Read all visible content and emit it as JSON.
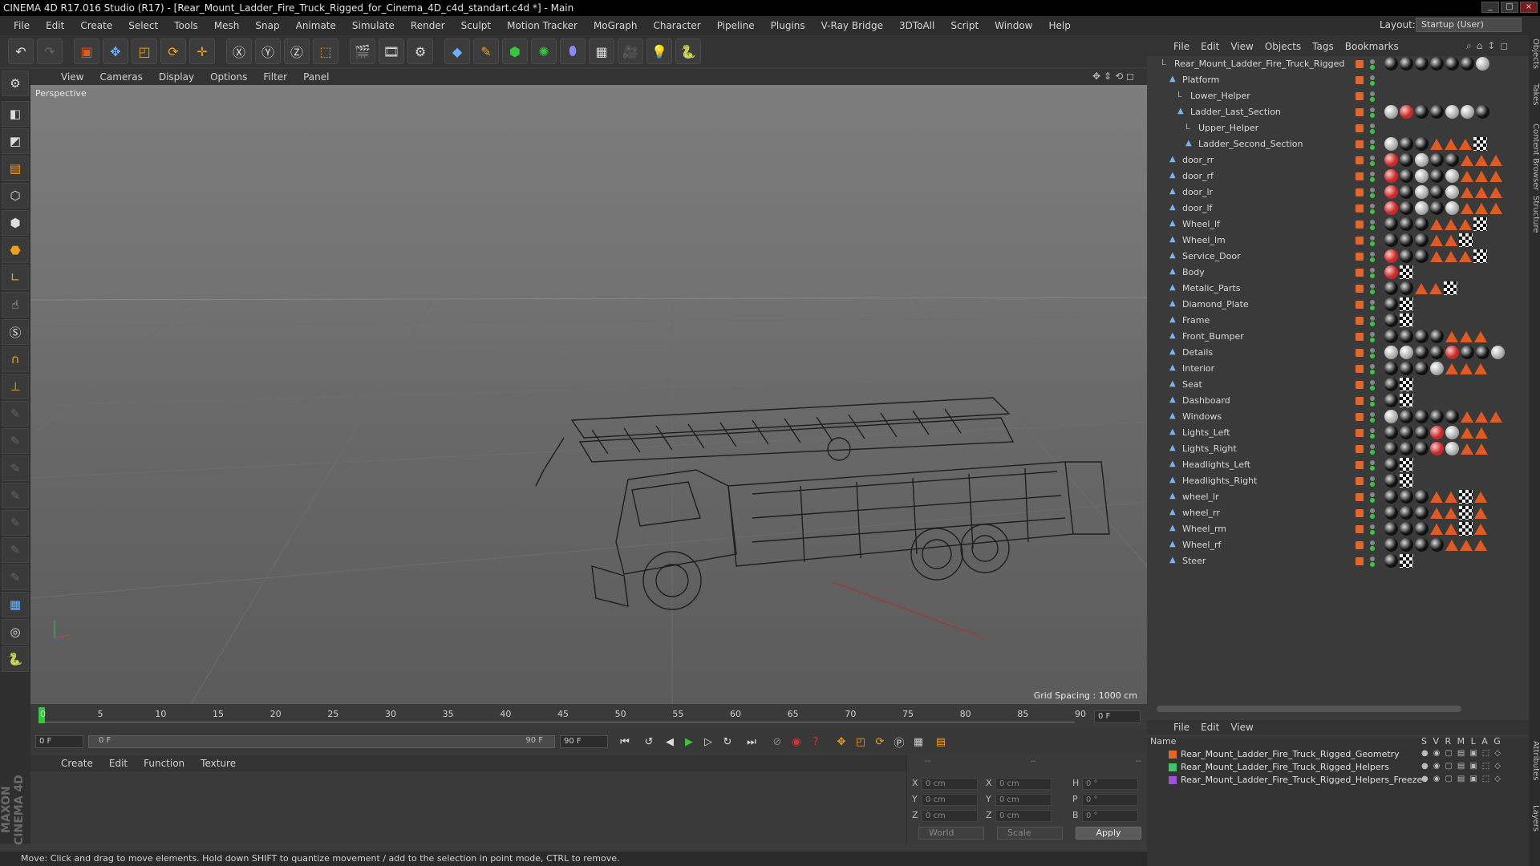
{
  "window": {
    "title": "CINEMA 4D R17.016 Studio (R17) - [Rear_Mount_Ladder_Fire_Truck_Rigged_for_Cinema_4D_c4d_standart.c4d *] - Main"
  },
  "menubar": {
    "items": [
      "File",
      "Edit",
      "Create",
      "Select",
      "Tools",
      "Mesh",
      "Snap",
      "Animate",
      "Simulate",
      "Render",
      "Sculpt",
      "Motion Tracker",
      "MoGraph",
      "Character",
      "Pipeline",
      "Plugins",
      "V-Ray Bridge",
      "3DToAll",
      "Script",
      "Window",
      "Help"
    ],
    "layout_label": "Layout:",
    "layout_value": "Startup (User)"
  },
  "viewport": {
    "menu": [
      "View",
      "Cameras",
      "Display",
      "Options",
      "Filter",
      "Panel"
    ],
    "label": "Perspective",
    "grid_spacing": "Grid Spacing : 1000 cm"
  },
  "timeline": {
    "ticks": [
      "0",
      "5",
      "10",
      "15",
      "20",
      "25",
      "30",
      "35",
      "40",
      "45",
      "50",
      "55",
      "60",
      "65",
      "70",
      "75",
      "80",
      "85",
      "90"
    ],
    "current_frame": "0 F",
    "start_field": "0 F",
    "slider_start": "0 F",
    "slider_end": "90 F",
    "end_field": "90 F"
  },
  "material_manager": {
    "menu": [
      "Create",
      "Edit",
      "Function",
      "Texture"
    ]
  },
  "coordinates": {
    "header": [
      "--",
      "--",
      "--"
    ],
    "rows": [
      {
        "l1": "X",
        "v1": "0 cm",
        "l2": "X",
        "v2": "0 cm",
        "l3": "H",
        "v3": "0 °"
      },
      {
        "l1": "Y",
        "v1": "0 cm",
        "l2": "Y",
        "v2": "0 cm",
        "l3": "P",
        "v3": "0 °"
      },
      {
        "l1": "Z",
        "v1": "0 cm",
        "l2": "Z",
        "v2": "0 cm",
        "l3": "B",
        "v3": "0 °"
      }
    ],
    "space": "World",
    "mode": "Scale",
    "apply": "Apply"
  },
  "status": {
    "text": "Move: Click and drag to move elements. Hold down SHIFT to quantize movement / add to the selection in point mode, CTRL to remove."
  },
  "object_manager": {
    "menu": [
      "File",
      "Edit",
      "View",
      "Objects",
      "Tags",
      "Bookmarks"
    ],
    "objects": [
      {
        "name": "Rear_Mount_Ladder_Fire_Truck_Rigged",
        "indent": 0,
        "icon": "null"
      },
      {
        "name": "Platform",
        "indent": 1,
        "icon": "bone"
      },
      {
        "name": "Lower_Helper",
        "indent": 2,
        "icon": "null"
      },
      {
        "name": "Ladder_Last_Section",
        "indent": 2,
        "icon": "bone"
      },
      {
        "name": "Upper_Helper",
        "indent": 3,
        "icon": "null"
      },
      {
        "name": "Ladder_Second_Section",
        "indent": 3,
        "icon": "bone"
      },
      {
        "name": "door_rr",
        "indent": 1,
        "icon": "bone"
      },
      {
        "name": "door_rf",
        "indent": 1,
        "icon": "bone"
      },
      {
        "name": "door_lr",
        "indent": 1,
        "icon": "bone"
      },
      {
        "name": "door_lf",
        "indent": 1,
        "icon": "bone"
      },
      {
        "name": "Wheel_lf",
        "indent": 1,
        "icon": "bone"
      },
      {
        "name": "Wheel_lm",
        "indent": 1,
        "icon": "bone"
      },
      {
        "name": "Service_Door",
        "indent": 1,
        "icon": "bone"
      },
      {
        "name": "Body",
        "indent": 1,
        "icon": "bone"
      },
      {
        "name": "Metalic_Parts",
        "indent": 1,
        "icon": "bone"
      },
      {
        "name": "Diamond_Plate",
        "indent": 1,
        "icon": "bone"
      },
      {
        "name": "Frame",
        "indent": 1,
        "icon": "bone"
      },
      {
        "name": "Front_Bumper",
        "indent": 1,
        "icon": "bone"
      },
      {
        "name": "Details",
        "indent": 1,
        "icon": "bone"
      },
      {
        "name": "Interior",
        "indent": 1,
        "icon": "bone"
      },
      {
        "name": "Seat",
        "indent": 1,
        "icon": "bone"
      },
      {
        "name": "Dashboard",
        "indent": 1,
        "icon": "bone"
      },
      {
        "name": "Windows",
        "indent": 1,
        "icon": "bone"
      },
      {
        "name": "Lights_Left",
        "indent": 1,
        "icon": "bone"
      },
      {
        "name": "Lights_Right",
        "indent": 1,
        "icon": "bone"
      },
      {
        "name": "Headlights_Left",
        "indent": 1,
        "icon": "bone"
      },
      {
        "name": "Headlights_Right",
        "indent": 1,
        "icon": "bone"
      },
      {
        "name": "wheel_lr",
        "indent": 1,
        "icon": "bone"
      },
      {
        "name": "wheel_rr",
        "indent": 1,
        "icon": "bone"
      },
      {
        "name": "Wheel_rm",
        "indent": 1,
        "icon": "bone"
      },
      {
        "name": "Wheel_rf",
        "indent": 1,
        "icon": "bone"
      },
      {
        "name": "Steer",
        "indent": 1,
        "icon": "bone"
      }
    ]
  },
  "layer_manager": {
    "menu": [
      "File",
      "Edit",
      "View"
    ],
    "head_name": "Name",
    "head_cols": "S V R M L A G",
    "layers": [
      {
        "name": "Rear_Mount_Ladder_Fire_Truck_Rigged_Geometry",
        "color": "#e0662c"
      },
      {
        "name": "Rear_Mount_Ladder_Fire_Truck_Rigged_Helpers",
        "color": "#3fc46a"
      },
      {
        "name": "Rear_Mount_Ladder_Fire_Truck_Rigged_Helpers_Freeze",
        "color": "#a050e0"
      }
    ]
  },
  "side_tabs": [
    "Objects",
    "Takes",
    "Content Browser",
    "Structure",
    "Attributes",
    "Layers"
  ]
}
